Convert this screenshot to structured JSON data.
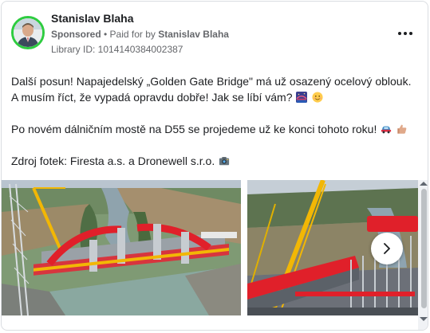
{
  "post": {
    "page_name": "Stanislav Blaha",
    "sponsored_label": "Sponsored",
    "separator": " • ",
    "paid_for_prefix": "Paid for by ",
    "paid_for_name": "Stanislav Blaha",
    "library_id": "Library ID: 1014140384002387",
    "text_line1": "Další posun! Napajedelský „Golden Gate Bridge\" má už osazený ocelový oblouk. A musím říct, že vypadá opravdu dobře! Jak se líbí vám?",
    "text_line2": "Po novém dálničním mostě na D55 se projedeme už ke konci tohoto roku!",
    "text_line3": "Zdroj fotek: Firesta a.s. a Dronewell s.r.o."
  },
  "icons": {
    "more": "more-options-icon",
    "next": "chevron-right-icon",
    "bridge_emoji": "bridge-at-night-emoji",
    "smile_emoji": "smiling-face-emoji",
    "car_emoji": "car-emoji",
    "thumbs_emoji": "thumbs-up-emoji",
    "camera_emoji": "camera-emoji"
  },
  "colors": {
    "avatar_ring": "#2ecc40",
    "text": "#1c1e21",
    "meta": "#65676b",
    "arch_red": "#e0202a",
    "crane_yellow": "#f2b705"
  }
}
